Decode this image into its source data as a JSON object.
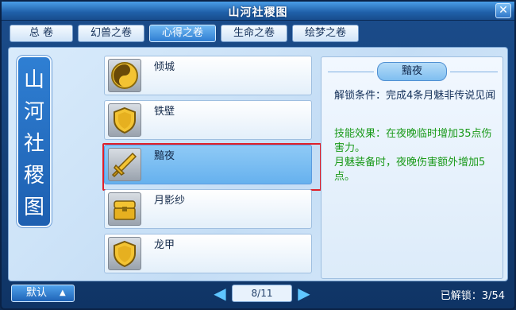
{
  "window": {
    "title": "山河社稷图",
    "close_label": "✕"
  },
  "tabs": [
    {
      "label": "总  卷",
      "active": false
    },
    {
      "label": "幻兽之卷",
      "active": false
    },
    {
      "label": "心得之卷",
      "active": true
    },
    {
      "label": "生命之卷",
      "active": false
    },
    {
      "label": "绘梦之卷",
      "active": false
    }
  ],
  "banner": {
    "chars": [
      "山",
      "河",
      "社",
      "稷",
      "图"
    ]
  },
  "items": [
    {
      "name": "倾城",
      "icon": "yin-yang-icon"
    },
    {
      "name": "铁壁",
      "icon": "shield-icon"
    },
    {
      "name": "黯夜",
      "icon": "sword-icon",
      "selected": true
    },
    {
      "name": "月影纱",
      "icon": "chest-icon"
    },
    {
      "name": "龙甲",
      "icon": "shield-icon"
    }
  ],
  "detail": {
    "title": "黯夜",
    "unlock_condition": "解锁条件：完成4条月魅非传说见闻",
    "effect_1": "技能效果：在夜晚临时增加35点伤害力。",
    "effect_2": "月魅装备时，夜晚伤害额外增加5点。"
  },
  "footer": {
    "sort_label": "默认",
    "page": "8/11",
    "unlocked": "已解锁：3/54"
  },
  "colors": {
    "accent": "#2f7ed2",
    "highlight": "#e0202a",
    "effect_text": "#1a9a1a"
  }
}
